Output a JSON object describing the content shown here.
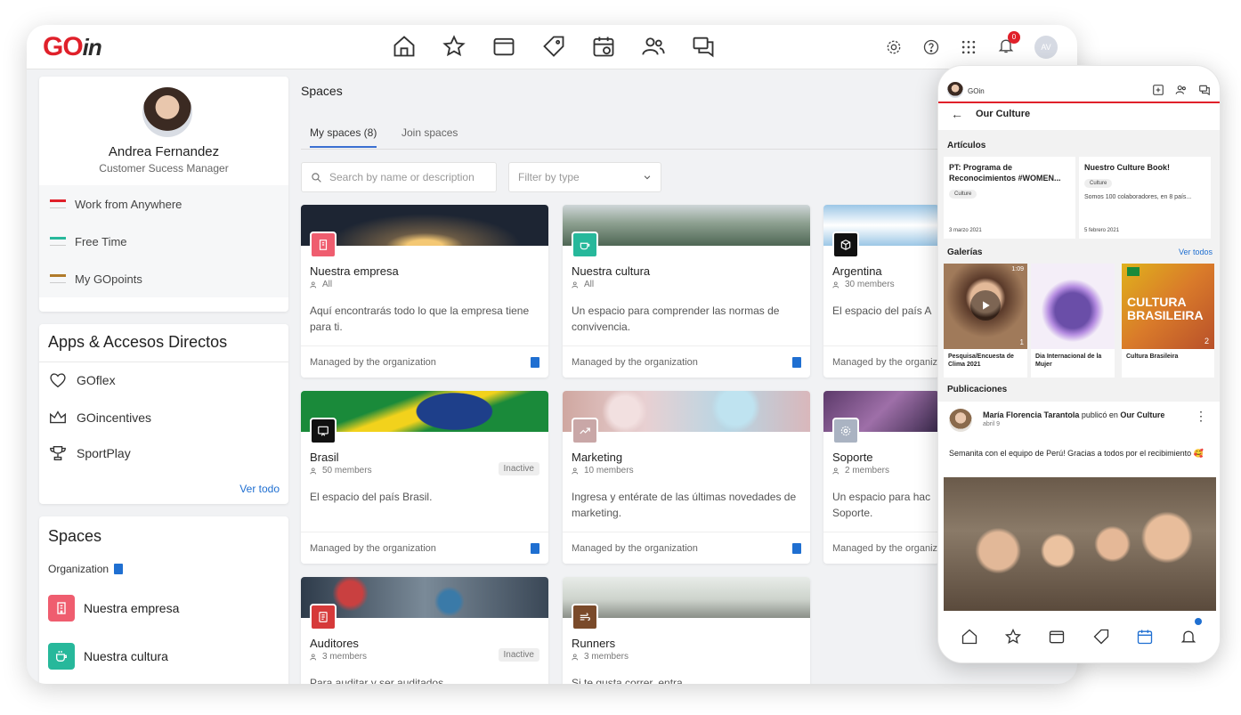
{
  "brand": {
    "logo_main": "GO",
    "logo_suffix": "in",
    "primary_color": "#e0202a",
    "accent_color": "#1f6fd1"
  },
  "topbar": {
    "avatar_initials": "AV",
    "notification_count": "0"
  },
  "profile": {
    "name": "Andrea Fernandez",
    "role": "Customer Sucess Manager",
    "items": [
      {
        "label": "Work from Anywhere",
        "color": "#e0202a"
      },
      {
        "label": "Free Time",
        "color": "#27b89b"
      },
      {
        "label": "My GOpoints",
        "color": "#b07a2a"
      }
    ]
  },
  "apps": {
    "title": "Apps & Accesos Directos",
    "items": [
      {
        "label": "GOflex",
        "icon": "heart-icon"
      },
      {
        "label": "GOincentives",
        "icon": "crown-icon"
      },
      {
        "label": "SportPlay",
        "icon": "trophy-icon"
      }
    ],
    "see_all": "Ver todo"
  },
  "left_spaces": {
    "title": "Spaces",
    "org_label": "Organization",
    "items": [
      {
        "label": "Nuestra empresa",
        "color": "#ef5d6f"
      },
      {
        "label": "Nuestra cultura",
        "color": "#27b89b"
      }
    ]
  },
  "main": {
    "title": "Spaces",
    "tabs": [
      "My spaces (8)",
      "Join spaces"
    ],
    "search_placeholder": "Search by name or description",
    "filter_placeholder": "Filter by type"
  },
  "space_cards": [
    {
      "title": "Nuestra empresa",
      "members": "All",
      "desc": "Aquí encontrarás todo lo que la empresa tiene para ti.",
      "foot": "Managed by the organization",
      "inactive": ""
    },
    {
      "title": "Nuestra cultura",
      "members": "All",
      "desc": "Un espacio para comprender las normas de convivencia.",
      "foot": "Managed by the organization",
      "inactive": ""
    },
    {
      "title": "Argentina",
      "members": "30 members",
      "desc": "El espacio del país A",
      "foot": "Managed by the organiz",
      "inactive": ""
    },
    {
      "title": "Brasil",
      "members": "50 members",
      "desc": "El espacio del país Brasil.",
      "foot": "Managed by the organization",
      "inactive": "Inactive"
    },
    {
      "title": "Marketing",
      "members": "10 members",
      "desc": "Ingresa y entérate de las últimas novedades de marketing.",
      "foot": "Managed by the organization",
      "inactive": ""
    },
    {
      "title": "Soporte",
      "members": "2 members",
      "desc": "Un espacio para hac Soporte.",
      "foot": "Managed by the organiz",
      "inactive": ""
    },
    {
      "title": "Auditores",
      "members": "3 members",
      "desc": "Para auditar y ser auditados",
      "foot": "",
      "inactive": "Inactive"
    },
    {
      "title": "Runners",
      "members": "3 members",
      "desc": "Si te gusta correr, entra",
      "foot": "",
      "inactive": ""
    }
  ],
  "phone": {
    "brand": "GOin",
    "page_title": "Our Culture",
    "articles_title": "Artículos",
    "articles": [
      {
        "title": "PT: Programa de Reconocimientos  #WOMEN...",
        "tag": "Culture",
        "desc": "",
        "date": "3 marzo 2021"
      },
      {
        "title": "Nuestro Culture Book!",
        "tag": "Culture",
        "desc": "Somos 100 colaboradores, en 8 país...",
        "date": "5 febrero 2021"
      }
    ],
    "gallery_title": "Galerías",
    "gallery_see_all": "Ver todos",
    "galleries": [
      {
        "caption": "Pesquisa/Encuesta de Clima 2021",
        "duration": "1:09",
        "count": "1"
      },
      {
        "caption": "Dia Internacional de la Mujer",
        "duration": "",
        "count": ""
      },
      {
        "caption": "Cultura Brasileira",
        "overlay": "CULTURA BRASILEIRA",
        "count": "2"
      }
    ],
    "posts_title": "Publicaciones",
    "post": {
      "author": "María Florencia Tarantola",
      "action": " publicó en ",
      "space": "Our Culture",
      "date": "abril 9",
      "text": "Semanita con el equipo de Perú! Gracias a todos por el recibimiento 🥰"
    }
  }
}
